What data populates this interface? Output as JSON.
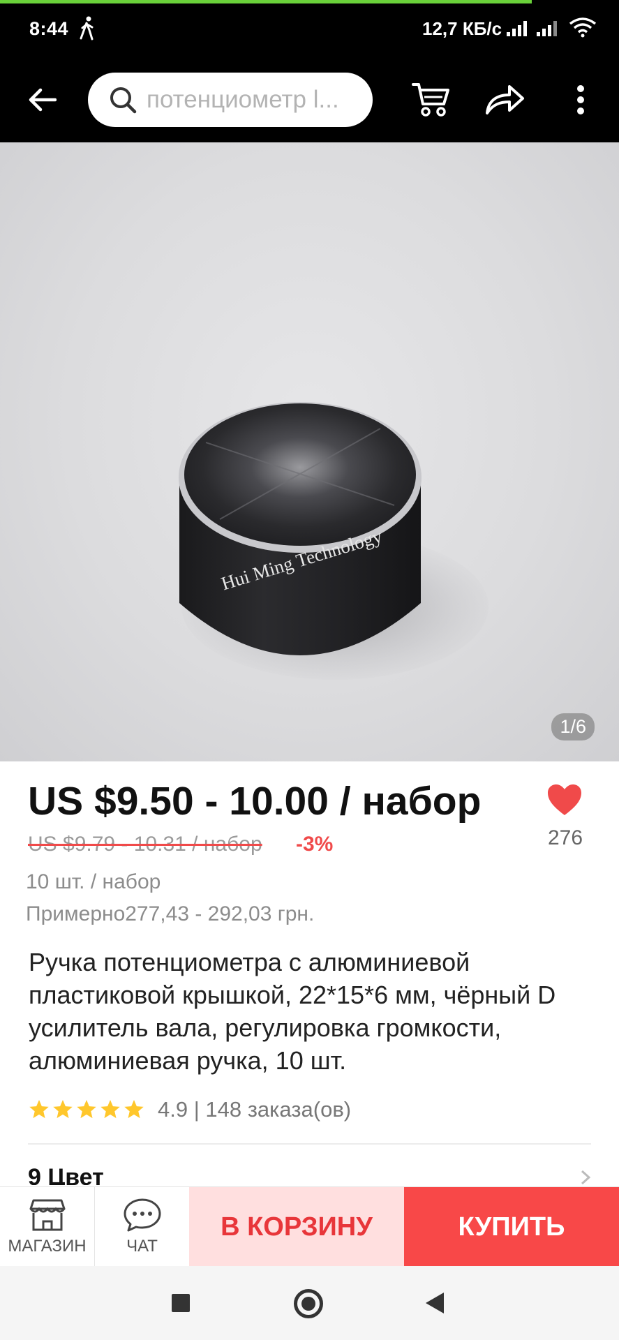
{
  "status_bar": {
    "time": "8:44",
    "net_speed": "12,7 КБ/с",
    "icons": [
      "walking-icon",
      "signal-icon",
      "signal-icon",
      "wifi-icon"
    ]
  },
  "toolbar": {
    "search_value": "потенциометр l...",
    "icons": [
      "back-arrow-icon",
      "search-icon",
      "cart-icon",
      "share-icon",
      "more-icon"
    ]
  },
  "product_image": {
    "watermark": "Hui Ming Technology",
    "counter": "1/6"
  },
  "price": {
    "current": "US $9.50 - 10.00 / набор",
    "original": "US $9.79 - 10.31 / набор",
    "discount": "-3%",
    "pieces_per_set": "10 шт. / набор",
    "approx_local": "Примерно277,43 - 292,03 грн."
  },
  "wishlist": {
    "count": "276",
    "icon": "heart-icon",
    "color": "#f04a4a"
  },
  "title": "Ручка потенциометра с алюминиевой пластиковой крышкой, 22*15*6 мм, чёрный D усилитель вала, регулировка громкости, алюминиевая ручка, 10 шт.",
  "rating": {
    "stars": 5,
    "value_and_orders": "4.9 | 148 заказа(ов)",
    "star_color": "#ffc72c"
  },
  "options": {
    "colors_label": "9 Цвет"
  },
  "action_bar": {
    "store_label": "МАГАЗИН",
    "chat_label": "ЧАТ",
    "add_to_cart_label": "В КОРЗИНУ",
    "buy_label": "КУПИТЬ",
    "accent_color": "#f84848"
  }
}
